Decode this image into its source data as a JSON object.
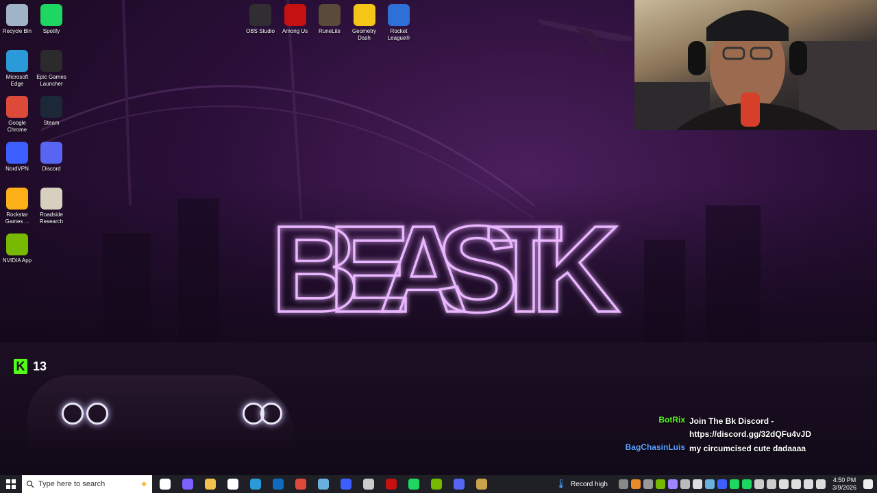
{
  "desktop_icons_left": [
    {
      "label": "Recycle Bin",
      "icon": "recycle-bin-icon",
      "color": "#9fb4c7"
    },
    {
      "label": "Spotify",
      "icon": "spotify-icon",
      "color": "#1ed760"
    },
    {
      "label": "Microsoft Edge",
      "icon": "edge-icon",
      "color": "#2a9bd8"
    },
    {
      "label": "Epic Games Launcher",
      "icon": "epic-games-icon",
      "color": "#2b2b2b"
    },
    {
      "label": "Google Chrome",
      "icon": "chrome-icon",
      "color": "#dd4a3a"
    },
    {
      "label": "Steam",
      "icon": "steam-icon",
      "color": "#1b2838"
    },
    {
      "label": "NordVPN",
      "icon": "nordvpn-icon",
      "color": "#3e5fff"
    },
    {
      "label": "Discord",
      "icon": "discord-icon",
      "color": "#5865f2"
    },
    {
      "label": "Rockstar Games ...",
      "icon": "rockstar-icon",
      "color": "#fcaf17"
    },
    {
      "label": "Roadside Research",
      "icon": "roadside-research-icon",
      "color": "#d8d0bf"
    },
    {
      "label": "NVIDIA App",
      "icon": "nvidia-icon",
      "color": "#76b900"
    }
  ],
  "desktop_icons_top": [
    {
      "label": "OBS Studio",
      "icon": "obs-icon",
      "color": "#302e31"
    },
    {
      "label": "Among Us",
      "icon": "among-us-icon",
      "color": "#c51111"
    },
    {
      "label": "RuneLite",
      "icon": "runelite-icon",
      "color": "#5a4a3a"
    },
    {
      "label": "Geometry Dash",
      "icon": "geometry-dash-icon",
      "color": "#f5c518"
    },
    {
      "label": "Rocket League®",
      "icon": "rocket-league-icon",
      "color": "#2f6fd8"
    }
  ],
  "wallpaper_title": "BEASTK",
  "kick": {
    "count": "13",
    "logo": "K",
    "color": "#53fc18"
  },
  "chat": [
    {
      "user": "BotRix",
      "user_color": "#53fc18",
      "message": "Join The Bk Discord - https://discord.gg/32dQFu4vJD"
    },
    {
      "user": "BagChasinLuis",
      "user_color": "#5aa0ff",
      "message": "my circumcised cute dadaaaa"
    }
  ],
  "taskbar": {
    "search_placeholder": "Type here to search",
    "apps": [
      {
        "name": "task-view-icon",
        "color": "#ffffff"
      },
      {
        "name": "copilot-icon",
        "color": "#7b61ff"
      },
      {
        "name": "file-explorer-icon",
        "color": "#f2c14e"
      },
      {
        "name": "store-icon",
        "color": "#ffffff"
      },
      {
        "name": "edge-taskbar-icon",
        "color": "#2a9bd8"
      },
      {
        "name": "outlook-icon",
        "color": "#0f6cbd"
      },
      {
        "name": "chrome-taskbar-icon",
        "color": "#dd4a3a"
      },
      {
        "name": "steam-taskbar-icon",
        "color": "#6ab0de"
      },
      {
        "name": "nordvpn-taskbar-icon",
        "color": "#3e5fff"
      },
      {
        "name": "obs-taskbar-icon",
        "color": "#cccccc"
      },
      {
        "name": "among-us-taskbar-icon",
        "color": "#c51111"
      },
      {
        "name": "spotify-taskbar-icon",
        "color": "#1ed760"
      },
      {
        "name": "nvidia-taskbar-icon",
        "color": "#76b900"
      },
      {
        "name": "discord-taskbar-icon",
        "color": "#5865f2"
      },
      {
        "name": "runelite-taskbar-icon",
        "color": "#c9a24a"
      }
    ],
    "record_label": "Record high",
    "time": "4:50 PM",
    "date": "3/9/2026"
  }
}
